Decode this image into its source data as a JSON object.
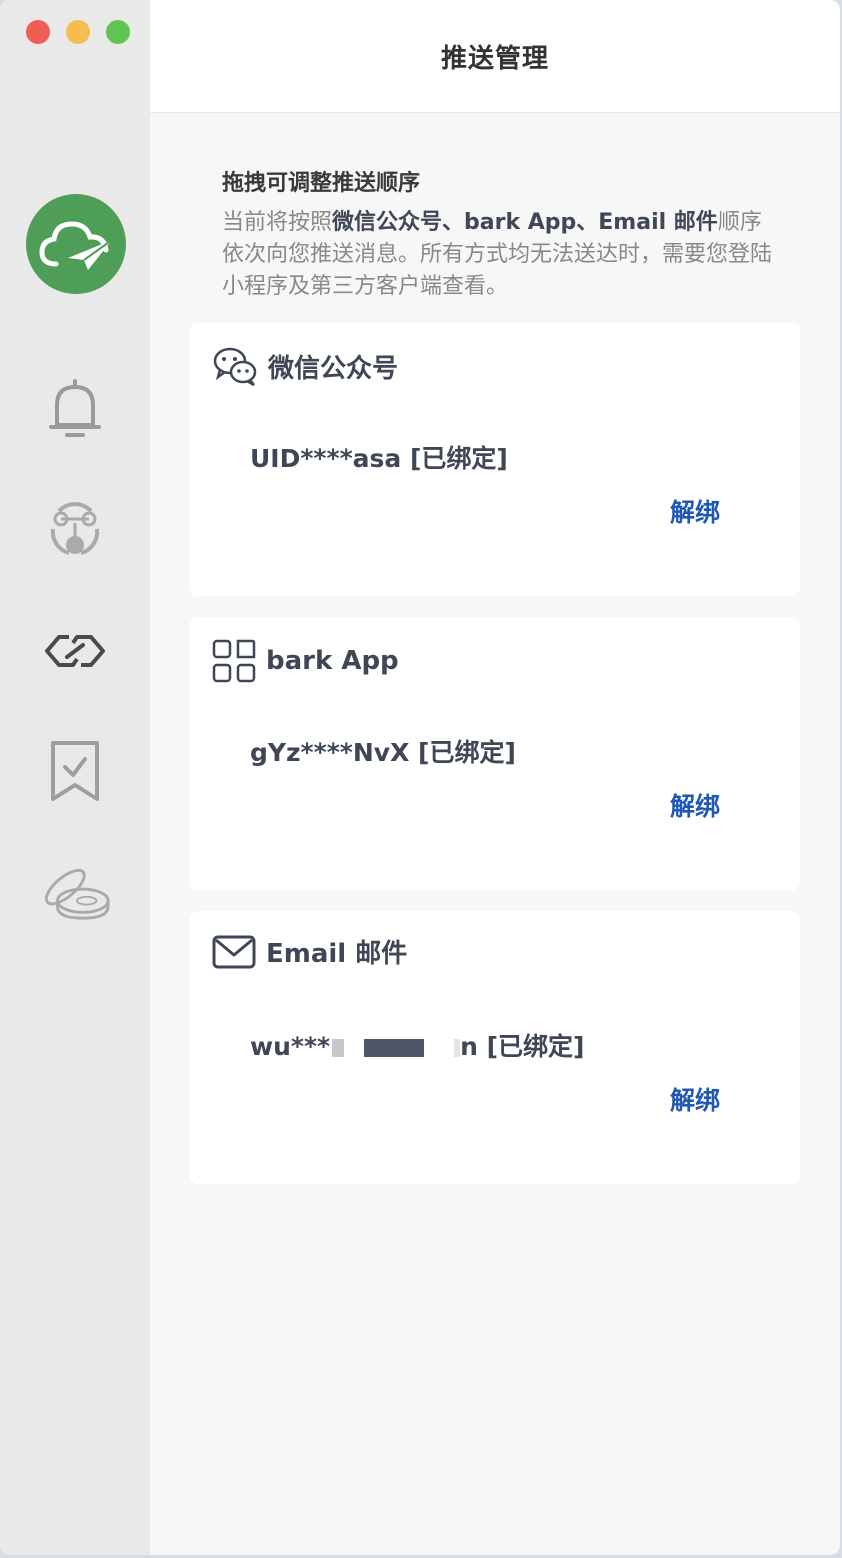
{
  "window": {
    "title": "推送管理"
  },
  "sidebar": {
    "items": [
      {
        "name": "bell-icon"
      },
      {
        "name": "robot-icon"
      },
      {
        "name": "link-icon"
      },
      {
        "name": "bookmark-check-icon"
      },
      {
        "name": "coins-icon"
      }
    ]
  },
  "intro": {
    "title": "拖拽可调整推送顺序",
    "desc_prefix": "当前将按照",
    "desc_bold": "微信公众号、bark App、Email 邮件",
    "desc_suffix": "顺序依次向您推送消息。所有方式均无法送达时，需要您登陆小程序及第三方客户端查看。"
  },
  "cards": [
    {
      "title": "微信公众号",
      "value": "UID****asa [已绑定]",
      "action": "解绑",
      "icon": "wechat-icon"
    },
    {
      "title": "bark App",
      "value": "gYz****NvX [已绑定]",
      "action": "解绑",
      "icon": "apps-grid-icon"
    },
    {
      "title": "Email 邮件",
      "value_start": "wu***",
      "value_end": "n [已绑定]",
      "action": "解绑",
      "icon": "mail-icon"
    }
  ],
  "colors": {
    "accent": "#2059b5",
    "logo": "#4e9e58",
    "text": "#3f4756"
  }
}
